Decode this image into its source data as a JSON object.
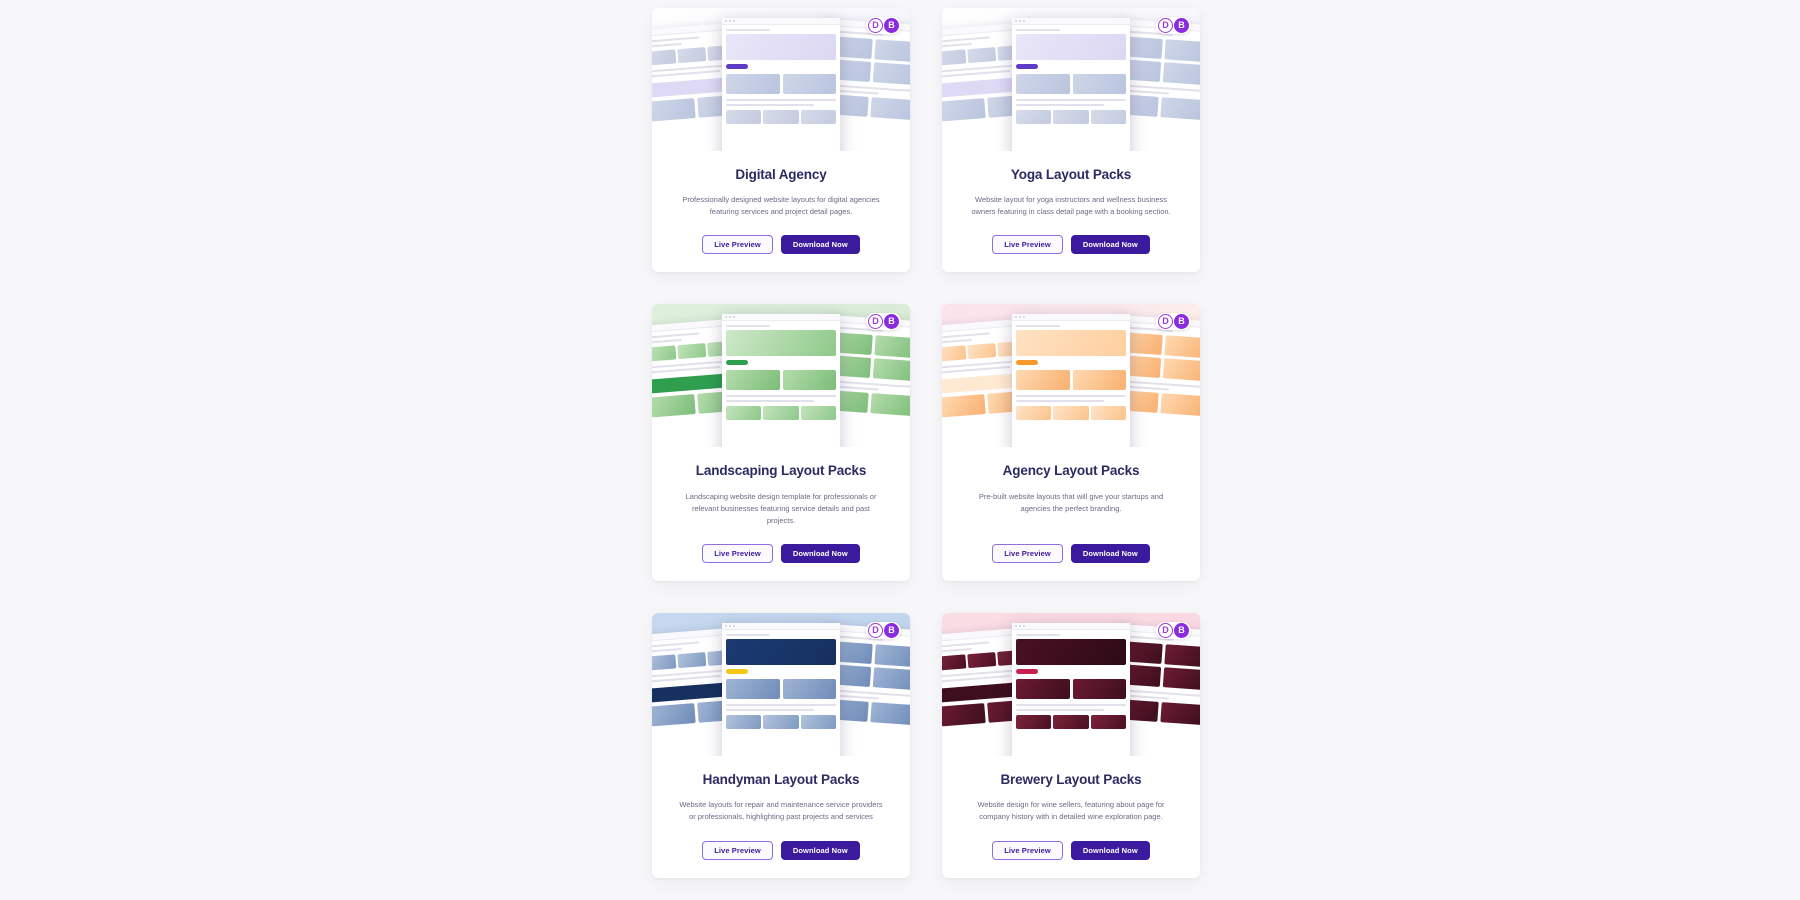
{
  "page": {
    "background_color": "#f7f7f9",
    "accent_color": "#3b1a9e",
    "title_color": "#2b2a63"
  },
  "badges": {
    "divi_label": "D",
    "divi_name": "divi-badge",
    "bloom_label": "B",
    "bloom_name": "bloom-badge",
    "divi_color": "#9c3ad6",
    "bloom_color": "#8a2be2"
  },
  "actions": {
    "preview_label": "Live Preview",
    "download_label": "Download Now"
  },
  "cards": [
    {
      "title": "Digital Agency",
      "description": "Professionally designed website layouts for digital agencies featuring services and project detail pages.",
      "thumb_theme": "agency",
      "mock_theme": "purple",
      "preview_label": "Live Preview",
      "download_label": "Download Now"
    },
    {
      "title": "Yoga Layout Packs",
      "description": "Website layout for yoga instructors and wellness business owners featuring in class detail page with a booking section.",
      "thumb_theme": "yoga",
      "mock_theme": "purple",
      "preview_label": "Live Preview",
      "download_label": "Download Now"
    },
    {
      "title": "Landscaping Layout Packs",
      "description": "Landscaping website design template for professionals or relevant businesses featuring service details and past projects.",
      "thumb_theme": "landscape",
      "mock_theme": "green",
      "preview_label": "Live Preview",
      "download_label": "Download Now"
    },
    {
      "title": "Agency Layout Packs",
      "description": "Pre-built website layouts that will give your startups and agencies the perfect branding.",
      "thumb_theme": "agencyp",
      "mock_theme": "orange",
      "preview_label": "Live Preview",
      "download_label": "Download Now"
    },
    {
      "title": "Handyman Layout Packs",
      "description": "Website layouts for repair and maintenance service providers or professionals, highlighting past projects and services",
      "thumb_theme": "handyman",
      "mock_theme": "blue",
      "preview_label": "Live Preview",
      "download_label": "Download Now"
    },
    {
      "title": "Brewery Layout Packs",
      "description": "Website design for wine sellers, featuring about page for company history with in detailed wine exploration page.",
      "thumb_theme": "brewery",
      "mock_theme": "wine",
      "preview_label": "Live Preview",
      "download_label": "Download Now"
    }
  ]
}
